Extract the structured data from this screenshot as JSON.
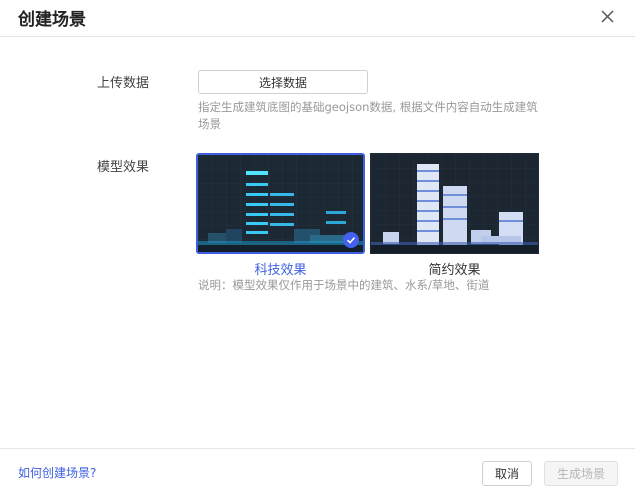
{
  "dialog": {
    "title": "创建场景",
    "close_icon": "close-icon"
  },
  "upload": {
    "label": "上传数据",
    "button_label": "选择数据",
    "hint": "指定生成建筑底图的基础geojson数据, 根据文件内容自动生成建筑场景"
  },
  "effect": {
    "label": "模型效果",
    "options": [
      {
        "label": "科技效果",
        "selected": true
      },
      {
        "label": "简约效果",
        "selected": false
      }
    ],
    "note": "说明：模型效果仅作用于场景中的建筑、水系/草地、街道",
    "colors": {
      "selected": "#3d5fe0",
      "thumb_bg": "#1e2a36"
    }
  },
  "footer": {
    "help_link": "如何创建场景?",
    "cancel_label": "取消",
    "generate_label": "生成场景"
  }
}
